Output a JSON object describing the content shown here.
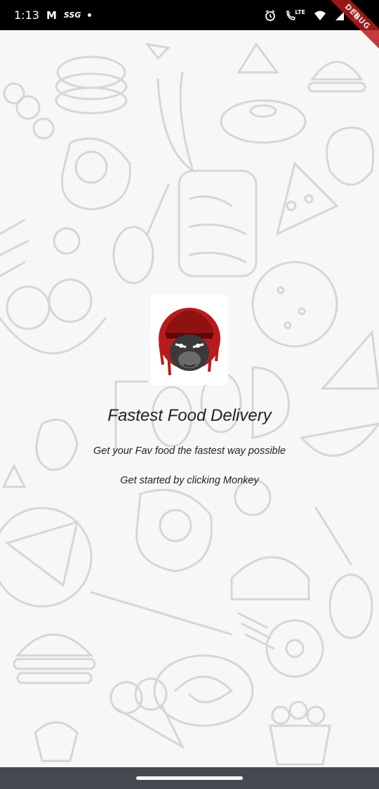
{
  "status_bar": {
    "time": "1:13",
    "gmail_icon": "M",
    "carrier_badge": "SSG",
    "network": "LTE",
    "debug_banner": "DEBUG"
  },
  "main": {
    "title": "Fastest Food Delivery",
    "subtitle": "Get your Fav food the fastest way possible",
    "hint": "Get started by clicking Monkey",
    "logo_icon": "monkey-logo-icon"
  },
  "colors": {
    "status_bar_bg": "#000000",
    "nav_bar_bg": "#454a50",
    "logo_red": "#b71c1c"
  }
}
